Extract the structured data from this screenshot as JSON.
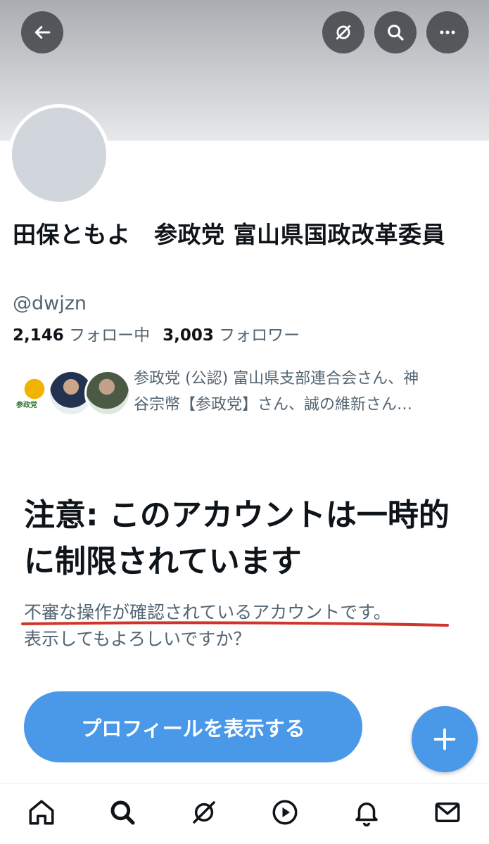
{
  "profile": {
    "name": "田保ともよ　参政党 富山県国政改革委員",
    "handle": "@dwjzn",
    "following_count": "2,146",
    "following_label": "フォロー中",
    "followers_count": "3,003",
    "followers_label": "フォロワー",
    "followed_by_line1": "参政党 (公認) 富山県支部連合会さん、神",
    "followed_by_line2": "谷宗幣【参政党】さん、誠の維新さん…",
    "followed_by_logo_text": "参政党"
  },
  "warning": {
    "title": "注意: このアカウントは一時的に制限されています",
    "subtitle_line1": "不審な操作が確認されているアカウントです。",
    "subtitle_line2": "表示してもよろしいですか？",
    "button_label": "プロフィールを表示する"
  },
  "header_icons": [
    "back-arrow-icon",
    "grok-icon",
    "search-icon",
    "more-icon"
  ],
  "nav": [
    "home-icon",
    "search-icon",
    "grok-icon",
    "play-icon",
    "bell-icon",
    "mail-icon"
  ],
  "colors": {
    "accent": "#4a99e9",
    "secondary_text": "#536471",
    "annotation_line": "#d0352b"
  }
}
